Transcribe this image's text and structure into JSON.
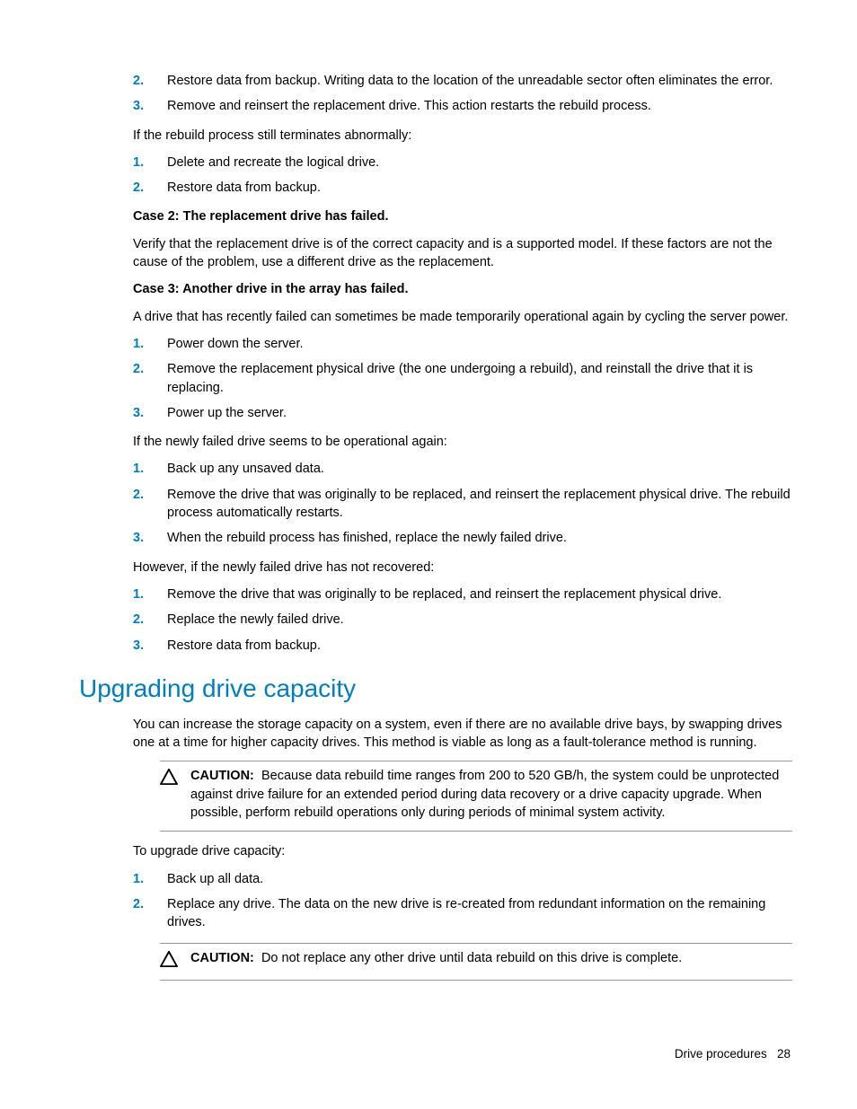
{
  "lists": {
    "top": [
      "Restore data from backup. Writing data to the location of the unreadable sector often eliminates the error.",
      "Remove and reinsert the replacement drive. This action restarts the rebuild process."
    ],
    "abnormal": [
      "Delete and recreate the logical drive.",
      "Restore data from backup."
    ],
    "case3a": [
      "Power down the server.",
      "Remove the replacement physical drive (the one undergoing a rebuild), and reinstall the drive that it is replacing.",
      "Power up the server."
    ],
    "case3b": [
      "Back up any unsaved data.",
      "Remove the drive that was originally to be replaced, and reinsert the replacement physical drive. The rebuild process automatically restarts.",
      "When the rebuild process has finished, replace the newly failed drive."
    ],
    "case3c": [
      "Remove the drive that was originally to be replaced, and reinsert the replacement physical drive.",
      "Replace the newly failed drive.",
      "Restore data from backup."
    ],
    "upgrade": [
      "Back up all data.",
      "Replace any drive. The data on the new drive is re-created from redundant information on the remaining drives."
    ]
  },
  "paras": {
    "p1": "If the rebuild process still terminates abnormally:",
    "case2h": "Case 2: The replacement drive has failed.",
    "case2p": "Verify that the replacement drive is of the correct capacity and is a supported model. If these factors are not the cause of the problem, use a different drive as the replacement.",
    "case3h": "Case 3: Another drive in the array has failed.",
    "case3p": "A drive that has recently failed can sometimes be made temporarily operational again by cycling the server power.",
    "case3p2": "If the newly failed drive seems to be operational again:",
    "case3p3": "However, if the newly failed drive has not recovered:",
    "upgHeading": "Upgrading drive capacity",
    "upgP1": "You can increase the storage capacity on a system, even if there are no available drive bays, by swapping drives one at a time for higher capacity drives. This method is viable as long as a fault-tolerance method is running.",
    "upgP2": "To upgrade drive capacity:"
  },
  "caution": {
    "label": "CAUTION:",
    "c1": "Because data rebuild time ranges from 200 to 520 GB/h, the system could be unprotected against drive failure for an extended period during data recovery or a drive capacity upgrade. When possible, perform rebuild operations only during periods of minimal system activity.",
    "c2": "Do not replace any other drive until data rebuild on this drive is complete."
  },
  "footer": {
    "section": "Drive procedures",
    "page": "28"
  }
}
